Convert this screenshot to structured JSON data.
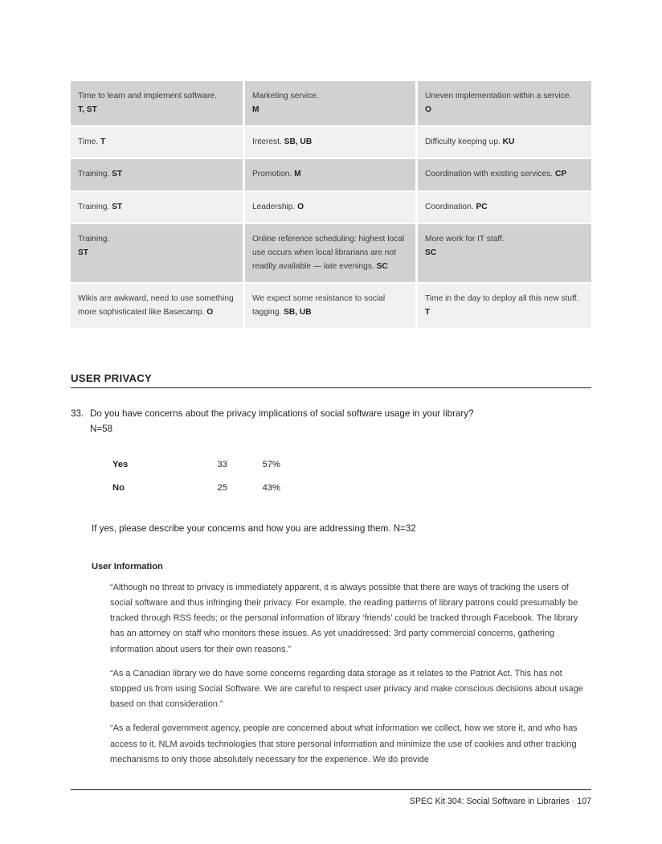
{
  "table": {
    "rows": [
      {
        "shade": "shade",
        "cells": [
          {
            "text": "Time to learn and implement software.",
            "code": "T, ST",
            "break": true
          },
          {
            "text": "Marketing service.",
            "code": "M",
            "break": true
          },
          {
            "text": "Uneven implementation within a service.",
            "code": "O",
            "break": true
          }
        ]
      },
      {
        "shade": "light",
        "cells": [
          {
            "text": "Time.",
            "code": "T",
            "break": false
          },
          {
            "text": "Interest.",
            "code": "SB, UB",
            "break": false
          },
          {
            "text": "Difficulty keeping up.",
            "code": "KU",
            "break": false
          }
        ]
      },
      {
        "shade": "shade",
        "cells": [
          {
            "text": "Training.",
            "code": "ST",
            "break": false
          },
          {
            "text": "Promotion.",
            "code": "M",
            "break": false
          },
          {
            "text": "Coordination with existing services.",
            "code": "CP",
            "break": false
          }
        ]
      },
      {
        "shade": "light",
        "cells": [
          {
            "text": "Training.",
            "code": "ST",
            "break": false
          },
          {
            "text": "Leadership.",
            "code": "O",
            "break": false
          },
          {
            "text": "Coordination.",
            "code": "PC",
            "break": false
          }
        ]
      },
      {
        "shade": "shade",
        "cells": [
          {
            "text": "Training.",
            "code": "ST",
            "break": true
          },
          {
            "text": "Online reference scheduling: highest local use occurs when local librarians are not readily available — late evenings.",
            "code": "SC",
            "break": false
          },
          {
            "text": "More work for IT staff.",
            "code": "SC",
            "break": true
          }
        ]
      },
      {
        "shade": "light",
        "cells": [
          {
            "text": "Wikis are awkward, need to use something more sophisticated like Basecamp.",
            "code": "O",
            "break": false
          },
          {
            "text": "We expect some resistance to social tagging.",
            "code": "SB, UB",
            "break": false
          },
          {
            "text": "Time in the day to deploy all this new stuff.",
            "code": "T",
            "break": true
          }
        ]
      }
    ]
  },
  "section": {
    "heading": "USER PRIVACY"
  },
  "question": {
    "number": "33.",
    "text": "Do you have concerns about the privacy implications of social software usage in your library?",
    "n": "N=58"
  },
  "results": {
    "rows": [
      {
        "label": "Yes",
        "count": "33",
        "pct": "57%"
      },
      {
        "label": "No",
        "count": "25",
        "pct": "43%"
      }
    ]
  },
  "followup": {
    "prompt": "If yes, please describe your concerns and how you are addressing them. N=32"
  },
  "comments": {
    "group_label": "User Information",
    "items": [
      "“Although no threat to privacy is immediately apparent, it is always possible that there are ways of tracking the users of social software and thus infringing their privacy. For example, the reading patterns of library patrons could presumably be tracked through RSS feeds; or the personal information of library ‘friends’ could be tracked through Facebook. The library has an attorney on staff who monitors these issues. As yet unaddressed: 3rd party commercial concerns, gathering information about users for their own reasons.”",
      "“As a Canadian library we do have some concerns regarding data storage as it relates to the Patriot Act. This has not stopped us from using Social Software. We are careful to respect user privacy and make conscious decisions about usage based on that consideration.”",
      "“As a federal government agency, people are concerned about what information we collect, how we store it, and who has access to it. NLM avoids technologies that store personal information and minimize the use of cookies and other tracking mechanisms to only those absolutely necessary for the experience. We do provide"
    ]
  },
  "footer": {
    "text": "SPEC Kit 304: Social Software in Libraries · 107"
  }
}
